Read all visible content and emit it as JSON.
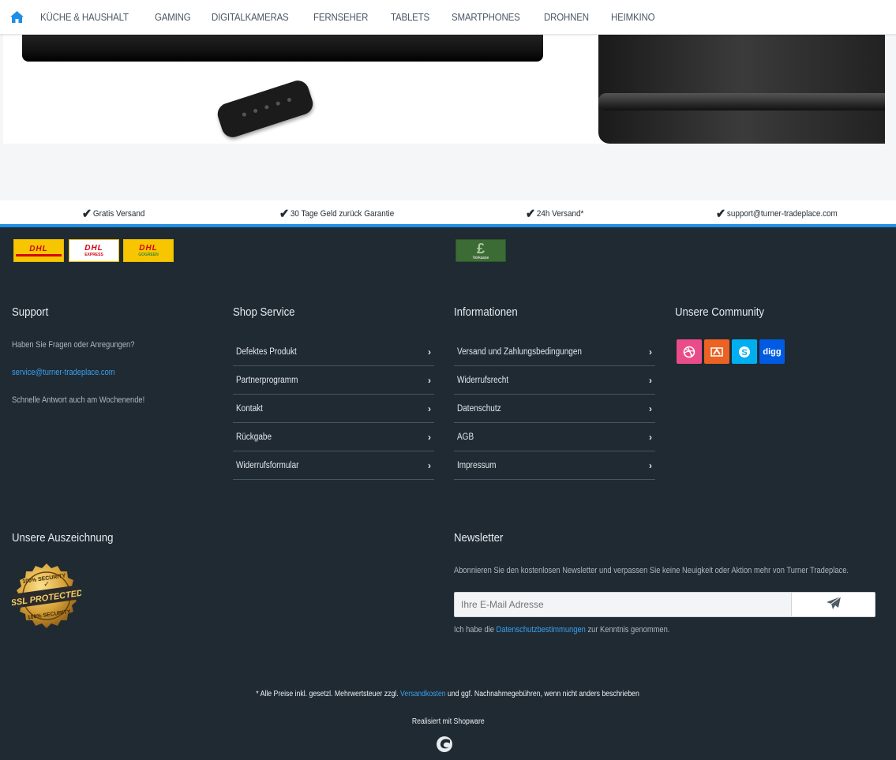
{
  "nav": {
    "home_icon": "home-icon",
    "items": [
      "KÜCHE & HAUSHALT",
      "GAMING",
      "DIGITALKAMERAS",
      "FERNSEHER",
      "TABLETS",
      "SMARTPHONES",
      "DROHNEN",
      "HEIMKINO"
    ]
  },
  "usp": {
    "items": [
      "Gratis Versand",
      "30 Tage Geld zurück Garantie",
      "24h Versand*",
      "support@turner-tradeplace.com"
    ]
  },
  "payment": {
    "dhl_sublabels": [
      "",
      "EXPRESS",
      "GOGREEN"
    ],
    "dhl_logo": "DHL",
    "vorkasse_symbol": "£",
    "vorkasse_label": "Vorkasse"
  },
  "support": {
    "title": "Support",
    "question": "Haben Sie Fragen oder Anregungen?",
    "email": "service@turner-tradeplace.com",
    "note": "Schnelle Antwort auch am Wochenende!"
  },
  "shop_service": {
    "title": "Shop Service",
    "items": [
      "Defektes Produkt",
      "Partnerprogramm",
      "Kontakt",
      "Rückgabe",
      "Widerrufsformular"
    ]
  },
  "informationen": {
    "title": "Informationen",
    "items": [
      "Versand und Zahlungsbedingungen",
      "Widerrufsrecht",
      "Datenschutz",
      "AGB",
      "Impressum"
    ]
  },
  "community": {
    "title": "Unsere Community",
    "icons": [
      "dribbble-icon",
      "stumbleupon-icon",
      "skype-icon",
      "digg-icon"
    ],
    "digg_label": "digg",
    "colors": [
      "#ea4c89",
      "#eb6223",
      "#00aff0",
      "#005be2"
    ]
  },
  "auszeichnung": {
    "title": "Unsere Auszeichnung",
    "seal_icon": "ssl-protected-seal"
  },
  "newsletter": {
    "title": "Newsletter",
    "text": "Abonnieren Sie den kostenlosen Newsletter und verpassen Sie keine Neuigkeit oder Aktion mehr von Turner Tradeplace.",
    "placeholder": "Ihre E-Mail Adresse",
    "consent_prefix": "Ich habe die",
    "consent_link": "Datenschutzbestimmungen",
    "consent_suffix": "zur Kenntnis genommen."
  },
  "bottom": {
    "vat_prefix": "* Alle Preise inkl. gesetzl. Mehrwertsteuer zzgl.",
    "vat_link": "Versandkosten",
    "vat_suffix": "und ggf. Nachnahmegebühren, wenn nicht anders beschrieben",
    "realized": "Realisiert mit Shopware"
  },
  "colors": {
    "footer_bg": "#1f2a33",
    "accent": "#1e8fe4",
    "link": "#3ba1f0"
  }
}
